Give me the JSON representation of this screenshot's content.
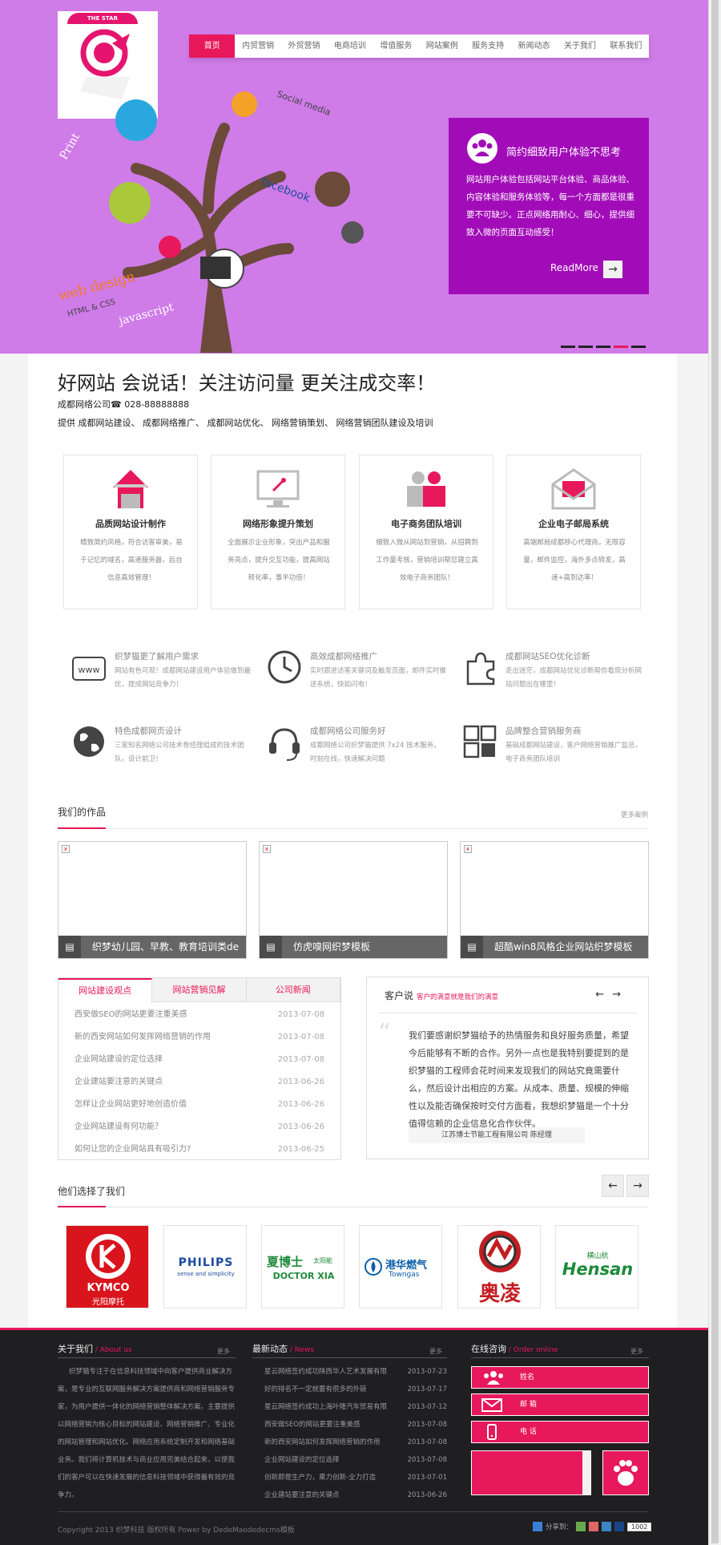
{
  "logo": {
    "band_text": "THE STAR"
  },
  "nav": {
    "items": [
      "首页",
      "内贸营销",
      "外贸营销",
      "电商培训",
      "增值服务",
      "网站案例",
      "服务支持",
      "新闻动态",
      "关于我们",
      "联系我们"
    ]
  },
  "banner": {
    "tree_words": [
      "Social media",
      "facebook",
      "Print",
      "web design",
      "HTML & CSS",
      "javascript"
    ],
    "slogan_title": "简约细致用户体验不思考",
    "slogan_desc": "网站用户体验包括网站平台体验、商品体验、内容体验和服务体验等，每一个方面都是很重要不可缺少。正点网络用耐心、细心，提供细致入微的页面互动感受！",
    "readmore": "ReadMore",
    "readmore_arrow": "→"
  },
  "headline": {
    "title": "好网站 会说话！关注访问量 更关注成交率！",
    "phone": "成都网络公司☎ 028-88888888",
    "sub": "提供 成都网站建设、 成都网络推广、 成都网站优化、 网络营销策划、 网络营销团队建设及培训"
  },
  "cards": [
    {
      "title": "品质网站设计制作",
      "desc": "精致简约风格，符合访客审美，易于记忆的域名，高速服务器，后台信息高效管理！"
    },
    {
      "title": "网络形象提升策划",
      "desc": "全面展示企业形象，突出产品和服务亮点，提升交互功能，提高网站转化率，事半功倍！"
    },
    {
      "title": "电子商务团队培训",
      "desc": "细致入微从网站到营销，从招聘到工作量考核，营销培训帮您建立高效电子商务团队！"
    },
    {
      "title": "企业电子邮局系统",
      "desc": "高端邮局成都移心代理商，无限容量，邮件监控，海外多点转发，高速+高到达率！"
    }
  ],
  "features": [
    {
      "title": "织梦猫更了解用户需求",
      "desc": "网站有色可观！成都网站建设用户体验做到最优，提成网站竞争力！"
    },
    {
      "title": "高效成都网络推广",
      "desc": "实时跟进访客关键词及触发页面，邮件实时推送系统，快如闪电！"
    },
    {
      "title": "成都网站SEO优化诊断",
      "desc": "走出迷茫，成都网站优化诊断帮你看现分析网站问题出在哪里！"
    },
    {
      "title": "特色成都网页设计",
      "desc": "三家知名网络公司技术骨经理组成的技术团队，设计前卫！"
    },
    {
      "title": "成都网络公司服务好",
      "desc": "成都网络公司织梦猫提供 7x24 技术服务，时刻在线，快速解决问题"
    },
    {
      "title": "品牌整合营销服务商",
      "desc": "基础成都网站建设，客户网络营销推广监总，电子商务团队培训"
    }
  ],
  "works": {
    "title": "我们的作品",
    "more": "更多案例",
    "items": [
      "织梦幼儿园、早教、教育培训类de",
      "仿虎嗅网织梦模板",
      "超酷win8风格企业网站织梦模板"
    ]
  },
  "news": {
    "tabs": [
      "网站建设观点",
      "网站营销见解",
      "公司新闻"
    ],
    "items": [
      {
        "t": "西安做SEO的网站更要注重美感",
        "d": "2013-07-08"
      },
      {
        "t": "新的西安网站如何发挥网络营销的作用",
        "d": "2013-07-08"
      },
      {
        "t": "企业网站建设的定位选择",
        "d": "2013-07-08"
      },
      {
        "t": "企业建站要注意的关键点",
        "d": "2013-06-26"
      },
      {
        "t": "怎样让企业网站更好地创造价值",
        "d": "2013-06-26"
      },
      {
        "t": "企业网站建设有何功能？",
        "d": "2013-06-26"
      },
      {
        "t": "如何让您的企业网站具有吸引力?",
        "d": "2013-06-25"
      }
    ]
  },
  "testimonial": {
    "title": "客户说",
    "subtitle": "客户的满意就是我们的满意",
    "nav": "←→",
    "quote_mark": "“",
    "text": "我们要感谢织梦猫给予的热情服务和良好服务质量，希望今后能够有不断的合作。另外一点也是我特别要提到的是织梦猫的工程师会花时间来发现我们的网站究竟需要什么，然后设计出相应的方案。从成本、质量、规模的伸缩性以及能否确保按时交付方面看，我想织梦猫是一个十分值得信赖的企业信息化合作伙伴。",
    "author": "江苏博士节能工程有限公司 陈经理"
  },
  "partners": {
    "title": "他们选择了我们",
    "prev": "←",
    "next": "→",
    "items": [
      {
        "name": "KYMCO",
        "sub": "光阳摩托"
      },
      {
        "name": "PHILIPS",
        "sub": "sense and simplicity"
      },
      {
        "name": "夏博士",
        "sub": "DOCTOR XIA",
        "tag": "太阳能"
      },
      {
        "name": "港华燃气",
        "sub": "Towngas"
      },
      {
        "name": "奥凌",
        "sub": ""
      },
      {
        "name": "Hensan",
        "sub": "横山航"
      }
    ]
  },
  "footer": {
    "about_title": "关于我们",
    "about_en": " / About us",
    "news_title": "最新动态",
    "news_en": " / News",
    "order_title": "在线咨询",
    "order_en": " / Order online",
    "more": "更多",
    "about_text": "织梦猫专注于在信息科技领域中向客户提供商业解决方案，是专业的互联网服务解决方案提供商和网络营销服务专家，为用户提供一体化的网络营销整体解决方案。主要提供以网络营销为核心目标的网站建设、网络营销推广、专业化的网站管理和网站优化。网络应用系统定制开发和网络基础业务。我们将计算机技术与商业应用完美结合起来，以使我们的客户可以在快速发展的信息科技领域中获得最有效的竞争力。",
    "news": [
      {
        "t": "星云网络签约成功陕西华人艺术发展有限",
        "d": "2013-07-23"
      },
      {
        "t": "好的排名不一定就要有很多的外链",
        "d": "2013-07-17"
      },
      {
        "t": "星云网络签约成功上海叶隆汽车贸易有限",
        "d": "2013-07-12"
      },
      {
        "t": "西安做SEO的网站更要注重美感",
        "d": "2013-07-08"
      },
      {
        "t": "新的西安网站如何发挥网络营销的作用",
        "d": "2013-07-08"
      },
      {
        "t": "企业网站建设的定位选择",
        "d": "2013-07-08"
      },
      {
        "t": "创新即是生产力，乘力创新-全力打造",
        "d": "2013-07-01"
      },
      {
        "t": "企业建站要注意的关键点",
        "d": "2013-06-26"
      }
    ],
    "form": {
      "name": "姓名",
      "email": "邮 箱",
      "phone": "电 话"
    },
    "copyright": "Copyright 2013 织梦科技 版权所有 Power by DedeMaodedecms模板",
    "share_label": "分享到：",
    "share_count": "1002"
  },
  "colors": {
    "banner": "#cf7be8",
    "accent": "#e7185b",
    "slogan_box": "#a20cb8",
    "footer": "#1f1e20"
  }
}
